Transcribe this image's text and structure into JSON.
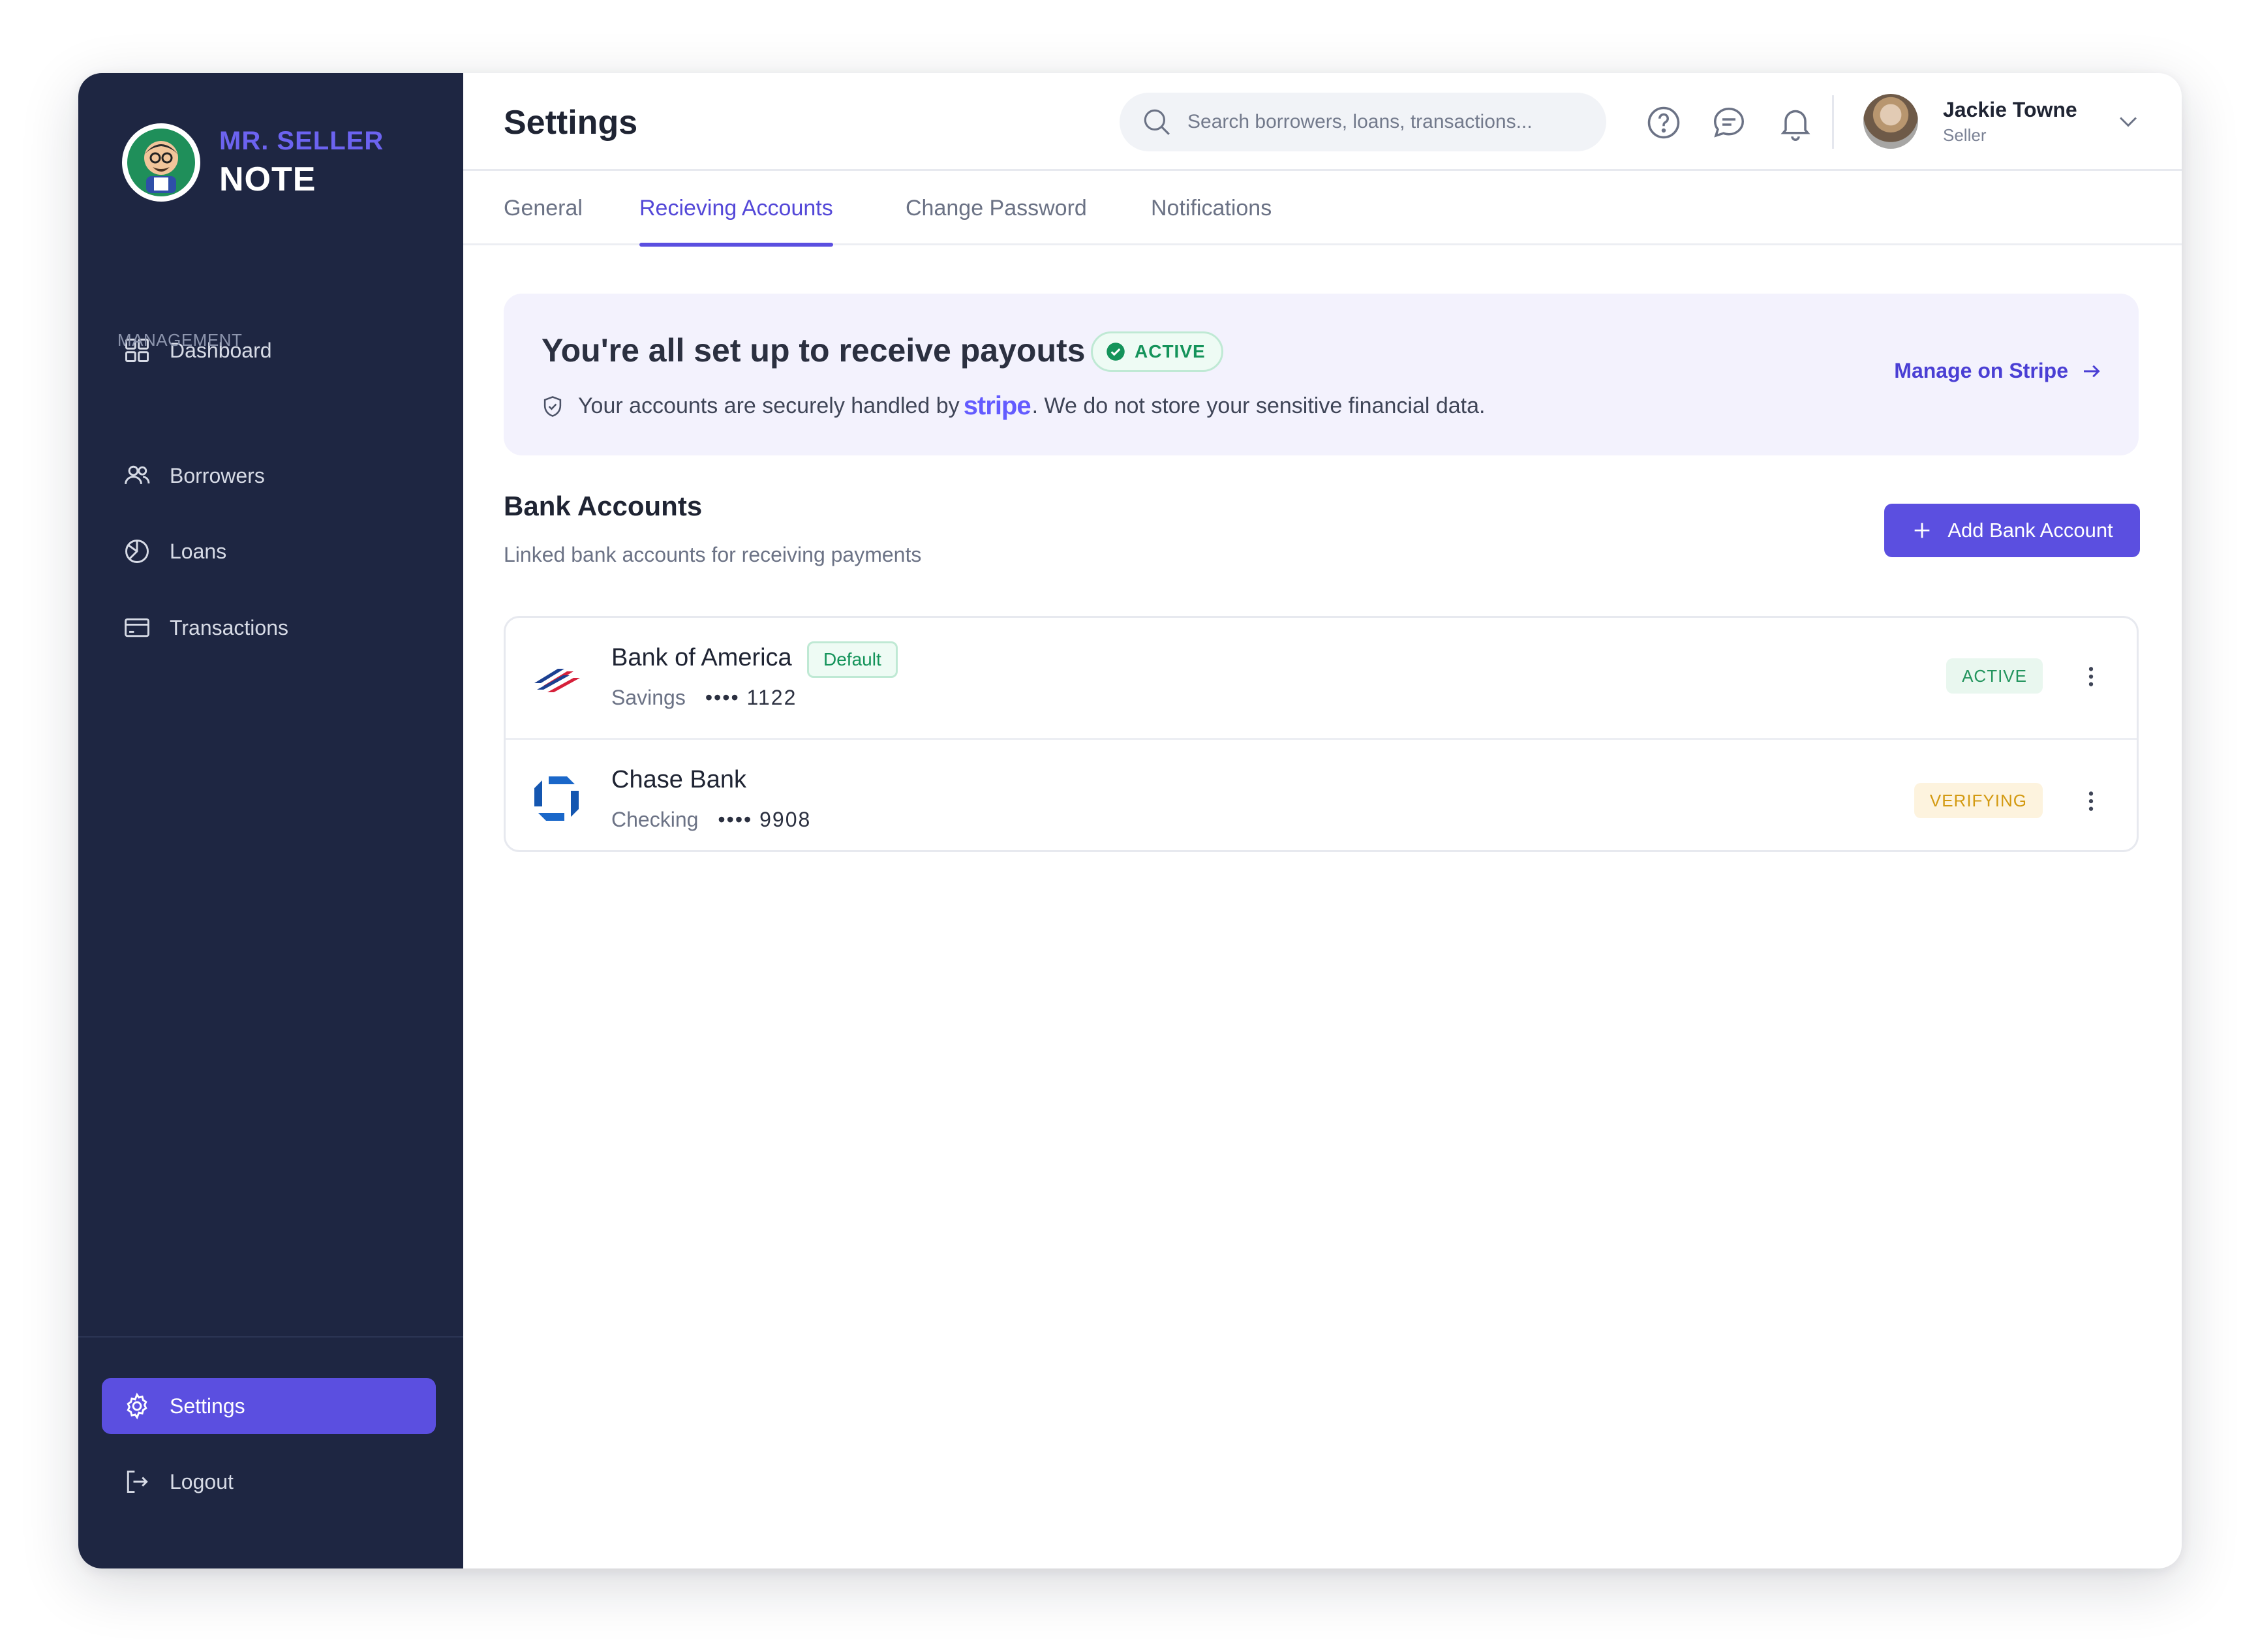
{
  "brand": {
    "line1": "MR. SELLER",
    "line2": "NOTE"
  },
  "sidebar": {
    "section_label": "MANAGEMENT",
    "items": [
      {
        "label": "Dashboard",
        "icon": "grid-icon"
      },
      {
        "label": "Borrowers",
        "icon": "users-icon"
      },
      {
        "label": "Loans",
        "icon": "pie-chart-icon"
      },
      {
        "label": "Transactions",
        "icon": "card-icon"
      }
    ],
    "bottom": [
      {
        "label": "Settings",
        "icon": "gear-icon",
        "active": true
      },
      {
        "label": "Logout",
        "icon": "logout-icon"
      }
    ]
  },
  "header": {
    "title": "Settings",
    "search_placeholder": "Search borrowers, loans, transactions...",
    "icons": [
      "help-icon",
      "chat-icon",
      "bell-icon"
    ],
    "user": {
      "name": "Jackie Towne",
      "role": "Seller"
    }
  },
  "tabs": [
    {
      "label": "General"
    },
    {
      "label": "Recieving Accounts",
      "active": true
    },
    {
      "label": "Change Password"
    },
    {
      "label": "Notifications"
    }
  ],
  "banner": {
    "title": "You're all set up to receive payouts",
    "status": "ACTIVE",
    "text_before": "Your accounts are securely handled by",
    "brand_word": "stripe",
    "text_after": ". We do not store your sensitive financial data.",
    "link": "Manage on Stripe"
  },
  "bank_section": {
    "title": "Bank Accounts",
    "subtitle": "Linked bank accounts for receiving payments",
    "add_button": "Add Bank Account",
    "accounts": [
      {
        "name": "Bank of America",
        "type": "Savings",
        "mask": "•••• 1122",
        "tag": "Default",
        "status": "ACTIVE"
      },
      {
        "name": "Chase Bank",
        "type": "Checking",
        "mask": "•••• 9908",
        "status": "VERIFYING"
      }
    ]
  },
  "colors": {
    "sidebar": "#1e2642",
    "accent": "#5b4fe0",
    "success": "#14935a",
    "warning": "#d39a12",
    "stripe": "#635bff"
  }
}
